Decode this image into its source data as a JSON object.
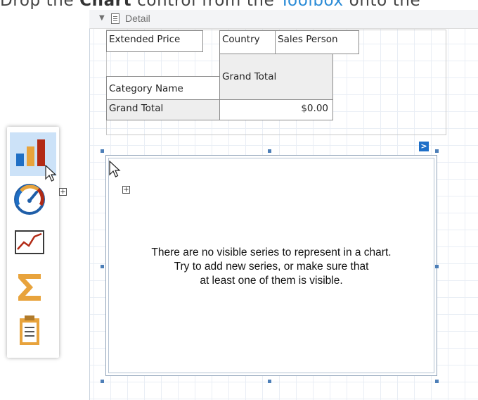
{
  "instruction": {
    "prefix": "Drop the ",
    "control": "Chart",
    "middle": " control from the ",
    "toolbox_link": "Toolbox",
    "suffix": " onto the"
  },
  "band": {
    "label": "Detail"
  },
  "pivot_grid": {
    "cells": {
      "data_field": "Extended Price",
      "column_field_1": "Country",
      "column_field_2": "Sales Person",
      "column_grand_total": "Grand Total",
      "row_field": "Category Name",
      "row_grand_total": "Grand Total",
      "value": "$0.00"
    }
  },
  "chart": {
    "empty_message_line1": "There are no visible series to represent in a chart.",
    "empty_message_line2": "Try to add new series, or make sure that",
    "empty_message_line3": "at least one of them is visible.",
    "smart_tag_glyph": ">"
  },
  "toolbox": {
    "items": [
      {
        "icon": "chart-icon",
        "selected": true
      },
      {
        "icon": "gauge-icon",
        "selected": false
      },
      {
        "icon": "sparkline-icon",
        "selected": false
      },
      {
        "icon": "summary-sigma-icon",
        "selected": false
      },
      {
        "icon": "clipboard-icon",
        "selected": false
      }
    ]
  },
  "colors": {
    "accent": "#1e6fc8",
    "link": "#2a8bd6",
    "selection": "#cce2f8",
    "chart_bar_blue": "#1f6fc5",
    "chart_bar_orange": "#e8a33c",
    "chart_bar_red": "#b22a15"
  }
}
